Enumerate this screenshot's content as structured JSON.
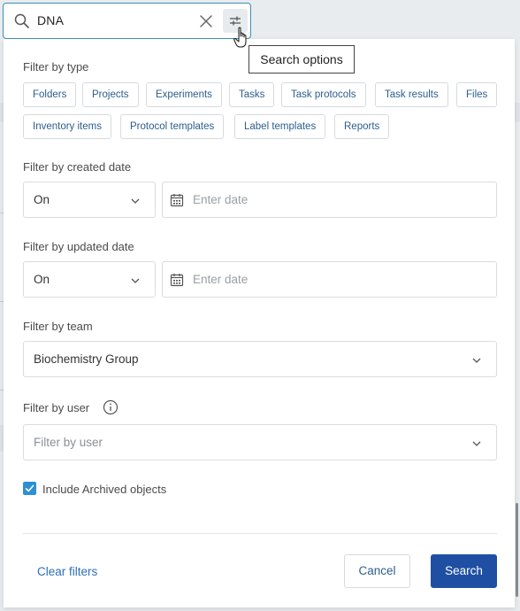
{
  "search": {
    "value": "DNA",
    "options_tooltip": "Search options"
  },
  "panel": {
    "filter_type": {
      "label": "Filter by type",
      "chips": [
        "Folders",
        "Projects",
        "Experiments",
        "Tasks",
        "Task protocols",
        "Task results",
        "Files",
        "Inventory items",
        "Protocol templates",
        "Label templates",
        "Reports"
      ]
    },
    "created": {
      "label": "Filter by created date",
      "operator": "On",
      "date_placeholder": "Enter date"
    },
    "updated": {
      "label": "Filter by updated date",
      "operator": "On",
      "date_placeholder": "Enter date"
    },
    "team": {
      "label": "Filter by team",
      "value": "Biochemistry Group"
    },
    "user": {
      "label": "Filter by user",
      "placeholder": "Filter by user"
    },
    "archived": {
      "label": "Include Archived objects",
      "checked": true
    },
    "footer": {
      "clear_label": "Clear filters",
      "cancel_label": "Cancel",
      "search_label": "Search"
    }
  },
  "colors": {
    "accent": "#1f4fa3",
    "link": "#2c6fb7",
    "checkbox": "#2d8fd5",
    "focus_border": "#3a8fb7"
  },
  "icons": [
    "search-icon",
    "close-icon",
    "sliders-icon",
    "pointer-hand-icon",
    "calendar-icon",
    "chevron-down-icon",
    "info-icon",
    "check-icon"
  ]
}
